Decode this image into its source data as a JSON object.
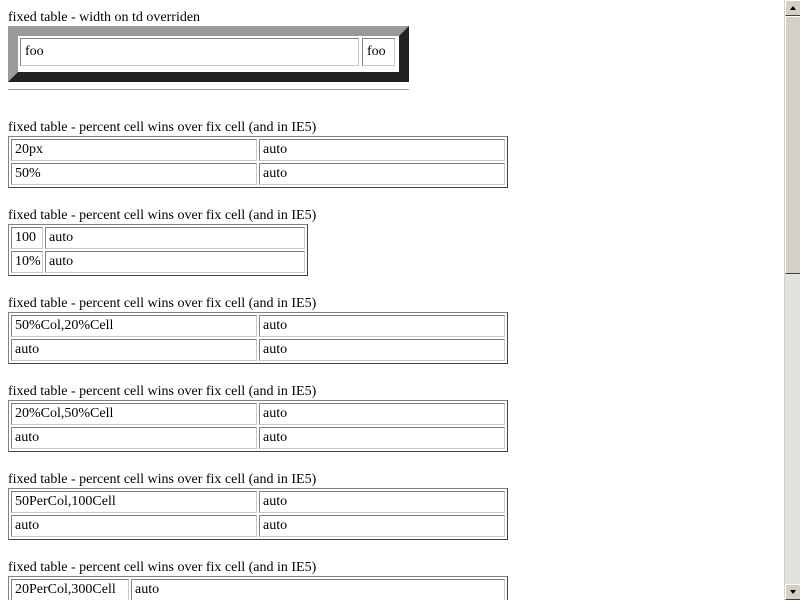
{
  "sections": [
    {
      "caption": "fixed table - width on td overriden",
      "rows": [
        [
          "foo",
          "foo"
        ]
      ]
    },
    {
      "caption": "fixed table - percent cell wins over fix cell (and in IE5)",
      "rows": [
        [
          "20px",
          "auto"
        ],
        [
          "50%",
          "auto"
        ]
      ]
    },
    {
      "caption": "fixed table - percent cell wins over fix cell (and in IE5)",
      "rows": [
        [
          "100",
          "auto"
        ],
        [
          "10%",
          "auto"
        ]
      ]
    },
    {
      "caption": "fixed table - percent cell wins over fix cell (and in IE5)",
      "rows": [
        [
          "50%Col,20%Cell",
          "auto"
        ],
        [
          "auto",
          "auto"
        ]
      ]
    },
    {
      "caption": "fixed table - percent cell wins over fix cell (and in IE5)",
      "rows": [
        [
          "20%Col,50%Cell",
          "auto"
        ],
        [
          "auto",
          "auto"
        ]
      ]
    },
    {
      "caption": "fixed table - percent cell wins over fix cell (and in IE5)",
      "rows": [
        [
          "50PerCol,100Cell",
          "auto"
        ],
        [
          "auto",
          "auto"
        ]
      ]
    },
    {
      "caption": "fixed table - percent cell wins over fix cell (and in IE5)",
      "rows": [
        [
          "20PerCol,300Cell",
          "auto"
        ]
      ]
    }
  ],
  "scrollbar": {
    "up_icon": "arrow-up-icon",
    "down_icon": "arrow-down-icon"
  }
}
